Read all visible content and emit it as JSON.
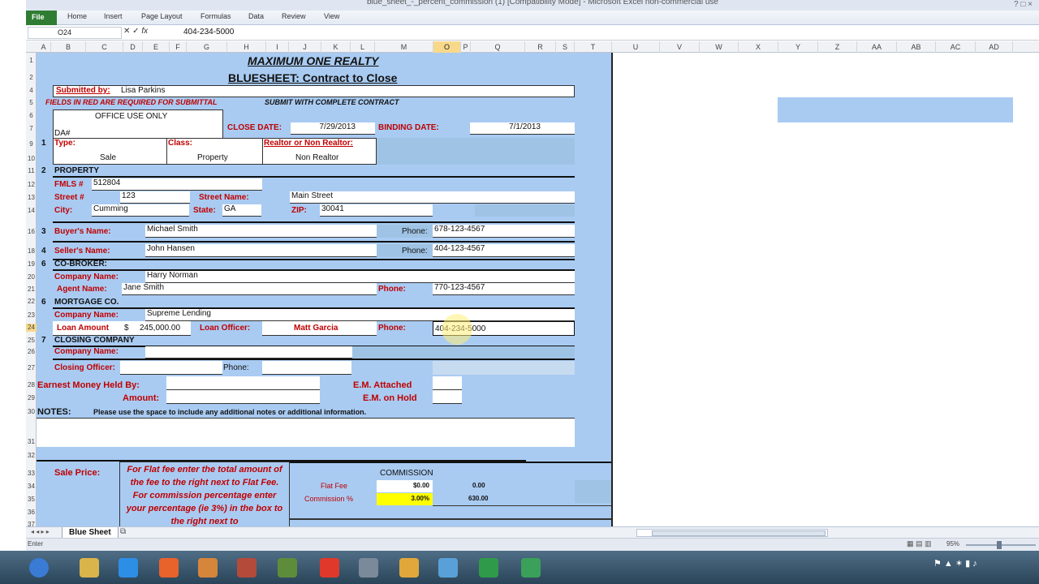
{
  "window": {
    "title": "blue_sheet_-_percent_commission (1)  [Compatibility Mode] - Microsoft Excel non-commercial use"
  },
  "ribbon": {
    "file": "File",
    "tabs": [
      "Home",
      "Insert",
      "Page Layout",
      "Formulas",
      "Data",
      "Review",
      "View"
    ]
  },
  "formula_bar": {
    "name_box": "O24",
    "fx": "fx",
    "value": "404-234-5000"
  },
  "columns": [
    "A",
    "B",
    "C",
    "D",
    "E",
    "F",
    "G",
    "H",
    "I",
    "J",
    "K",
    "L",
    "M",
    "O",
    "P",
    "Q",
    "R",
    "S",
    "T",
    "U",
    "V",
    "W",
    "X",
    "Y",
    "Z",
    "AA",
    "AB",
    "AC",
    "AD"
  ],
  "rows": [
    "1",
    "2",
    "4",
    "5",
    "6",
    "7",
    "9",
    "10",
    "11",
    "12",
    "13",
    "14",
    "16",
    "18",
    "19",
    "20",
    "21",
    "22",
    "23",
    "24",
    "25",
    "26",
    "27",
    "28",
    "29",
    "30",
    "31",
    "32",
    "33",
    "34",
    "35",
    "36",
    "37"
  ],
  "form": {
    "company": "MAXIMUM ONE REALTY",
    "subtitle": "BLUESHEET: Contract to Close",
    "submitted_by_label": "Submitted by:",
    "submitted_by": "Lisa Parkins",
    "required_note": "FIELDS IN RED ARE REQUIRED FOR SUBMITTAL",
    "submit_note": "SUBMIT WITH COMPLETE CONTRACT",
    "office_use": "OFFICE USE ONLY",
    "da_label": "DA#",
    "close_date_label": "CLOSE DATE:",
    "close_date": "7/29/2013",
    "binding_date_label": "BINDING DATE:",
    "binding_date": "7/1/2013",
    "sec1_num": "1",
    "type_label": "Type:",
    "type_value": "Sale",
    "class_label": "Class:",
    "class_value": "Property",
    "realtor_label": "Realtor or Non Realtor:",
    "realtor_value": "Non Realtor",
    "sec2_num": "2",
    "property_label": "PROPERTY",
    "fmls_label": "FMLS #",
    "fmls": "512804",
    "street_num_label": "Street #",
    "street_num": "123",
    "street_name_label": "Street Name:",
    "street_name": "Main Street",
    "city_label": "City:",
    "city": "Cumming",
    "state_label": "State:",
    "state": "GA",
    "zip_label": "ZIP:",
    "zip": "30041",
    "sec3_num": "3",
    "buyer_label": "Buyer's Name:",
    "buyer": "Michael Smith",
    "phone_label": "Phone:",
    "buyer_phone": "678-123-4567",
    "sec4_num": "4",
    "seller_label": "Seller's Name:",
    "seller": "John Hansen",
    "seller_phone": "404-123-4567",
    "sec6_num": "6",
    "cobroker_label": "CO-BROKER:",
    "company_name_label": "Company Name:",
    "cobroker_company": "Harry Norman",
    "agent_name_label": "Agent Name:",
    "agent_name": "Jane Smith",
    "agent_phone": "770-123-4567",
    "sec6b_num": "6",
    "mortgage_label": "MORTGAGE CO.",
    "mortgage_company": "Supreme Lending",
    "loan_amount_label": "Loan Amount",
    "loan_currency": "$",
    "loan_amount": "245,000.00",
    "loan_officer_label": "Loan Officer:",
    "loan_officer": "Matt Garcia",
    "loan_phone": "404-234-5000",
    "sec7_num": "7",
    "closing_label": "CLOSING COMPANY",
    "closing_officer_label": "Closing Officer:",
    "closing_phone_label": "Phone:",
    "earnest_label": "Earnest Money Held By:",
    "amount_label": "Amount:",
    "em_attached": "E.M. Attached",
    "em_hold": "E.M. on Hold",
    "notes_label": "NOTES:",
    "notes_text": "Please use the space to include any additional notes or additional information.",
    "sale_price_label": "Sale Price:",
    "flat_fee_instructions": "For Flat fee enter the total amount of the fee to the right next to Flat Fee. For commission percentage enter your percentage (ie 3%) in the box to the right next to",
    "commission_label": "COMMISSION",
    "flat_fee_label": "Flat Fee",
    "flat_fee_value": "$0.00",
    "flat_fee_result": "0.00",
    "commission_pct_label": "Commission %",
    "commission_pct": "3.00%",
    "commission_result": "630.00"
  },
  "sheet_tab": "Blue Sheet",
  "status": {
    "mode": "Enter",
    "zoom": "95%"
  },
  "colors": {
    "sheet_blue": "#a9cbf2",
    "label_red": "#c00000",
    "highlight_yellow": "#ffff00",
    "excel_green": "#2f7d32"
  },
  "taskbar_icons": [
    "windows-start-icon",
    "file-explorer-icon",
    "internet-explorer-icon",
    "firefox-icon",
    "media-player-icon",
    "printer-icon",
    "hp-icon",
    "chrome-icon",
    "screen-capture-icon",
    "outlook-icon",
    "paint-icon",
    "excel-icon",
    "talk-icon"
  ]
}
